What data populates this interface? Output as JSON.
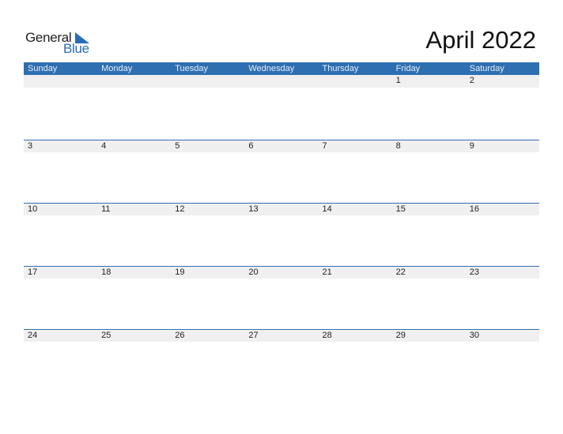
{
  "logo": {
    "word1": "General",
    "word2": "Blue"
  },
  "title": "April 2022",
  "colors": {
    "accent": "#2e6fb2",
    "strip": "#f0f0f0"
  },
  "weekdays": [
    "Sunday",
    "Monday",
    "Tuesday",
    "Wednesday",
    "Thursday",
    "Friday",
    "Saturday"
  ],
  "weeks": [
    [
      "",
      "",
      "",
      "",
      "",
      "1",
      "2"
    ],
    [
      "3",
      "4",
      "5",
      "6",
      "7",
      "8",
      "9"
    ],
    [
      "10",
      "11",
      "12",
      "13",
      "14",
      "15",
      "16"
    ],
    [
      "17",
      "18",
      "19",
      "20",
      "21",
      "22",
      "23"
    ],
    [
      "24",
      "25",
      "26",
      "27",
      "28",
      "29",
      "30"
    ]
  ]
}
